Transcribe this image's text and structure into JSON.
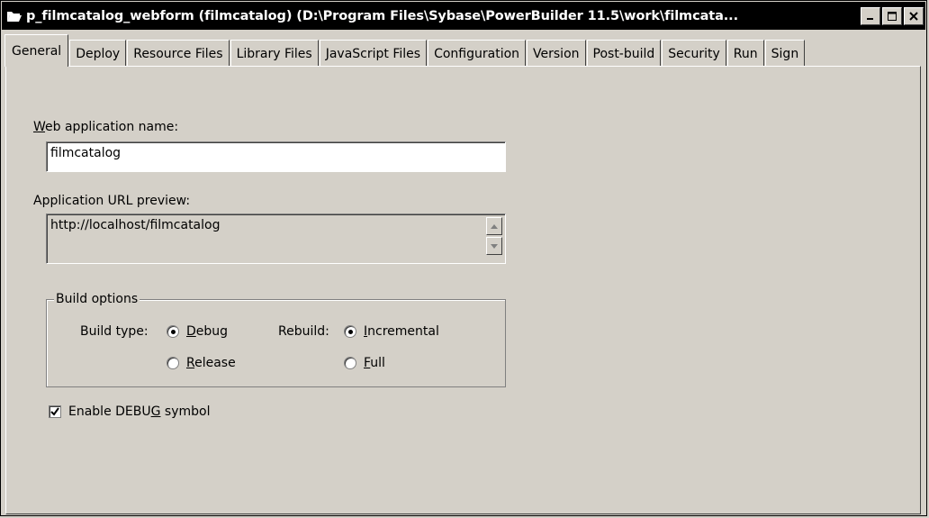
{
  "window": {
    "title": "p_filmcatalog_webform (filmcatalog) (D:\\Program Files\\Sybase\\PowerBuilder 11.5\\work\\filmcata...",
    "icon": "folder-open-icon",
    "buttons": {
      "minimize": "_",
      "maximize": "□",
      "close": "✕"
    }
  },
  "tabs": [
    {
      "label": "General",
      "active": true
    },
    {
      "label": "Deploy"
    },
    {
      "label": "Resource Files"
    },
    {
      "label": "Library Files"
    },
    {
      "label": "JavaScript Files"
    },
    {
      "label": "Configuration"
    },
    {
      "label": "Version"
    },
    {
      "label": "Post-build"
    },
    {
      "label": "Security"
    },
    {
      "label": "Run"
    },
    {
      "label": "Sign"
    }
  ],
  "general": {
    "web_app_name_label_rest": "eb application name:",
    "web_app_name_label_accel": "W",
    "web_app_name_value": "filmcatalog",
    "url_preview_label": "Application URL preview:",
    "url_preview_value": "http://localhost/filmcatalog",
    "build_options": {
      "legend": "Build options",
      "build_type_label": "Build type:",
      "debug_accel": "D",
      "debug_rest": "ebug",
      "release_accel": "R",
      "release_rest": "elease",
      "rebuild_label": "Rebuild:",
      "incremental_accel": "I",
      "incremental_rest": "ncremental",
      "full_accel": "F",
      "full_rest": "ull",
      "build_type_selected": "Debug",
      "rebuild_selected": "Incremental"
    },
    "enable_debug_pre": "Enable DEBU",
    "enable_debug_accel": "G",
    "enable_debug_post": " symbol",
    "enable_debug_checked": true
  }
}
